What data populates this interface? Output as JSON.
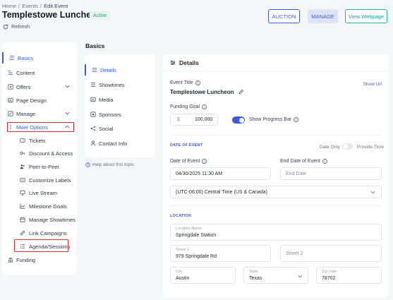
{
  "breadcrumb": {
    "home": "Home",
    "sep1": "/",
    "events": "Events",
    "sep2": "/",
    "current": "Edit Event"
  },
  "page": {
    "title": "Templestowe Luncheon",
    "status": "Active",
    "refresh": "Refresh"
  },
  "header_buttons": {
    "auction": "AUCTION",
    "manage": "MANAGE",
    "view": "View Webpage"
  },
  "sidebar": {
    "basics": "Basics",
    "content": "Content",
    "offers": "Offers",
    "page_design": "Page Design",
    "manage": "Manage",
    "more_options": "More Options",
    "sub": [
      "Tickets",
      "Discount & Access",
      "Peer-to-Peer",
      "Customize Labels",
      "Live Stream",
      "Milestone Goals",
      "Manage Showtimes",
      "Link Campaigns",
      "Agenda/Sessions"
    ],
    "funding": "Funding"
  },
  "basics_title": "Basics",
  "mid_nav": [
    "Details",
    "Showtimes",
    "Media",
    "Sponsors",
    "Social",
    "Contact Info"
  ],
  "help_link": "Help about this topic",
  "details": {
    "heading": "Details",
    "event_title_label": "Event Title",
    "show_url": "Show Url",
    "event_title_value": "Templestowe Luncheon",
    "funding_goal_label": "Funding Goal",
    "currency": "$",
    "funding_goal_value": "100,000",
    "show_progress_bar": "Show Progress Bar",
    "date_section": "DATE OF EVENT",
    "date_only": "Date Only",
    "provide_time": "Provide Time",
    "date_label": "Date of Event",
    "date_value": "04/30/2025 11:30 AM",
    "end_date_label": "End Date of Event",
    "end_date_placeholder": "End Date",
    "timezone": "(UTC-06:00) Central Time (US & Canada)",
    "location_section": "LOCATION",
    "location_name_label": "Location Name",
    "location_name": "Springdale Station",
    "street1_label": "Street 1",
    "street1": "979 Springdale Rd",
    "street2_placeholder": "Street 2",
    "city_label": "City",
    "city": "Austin",
    "state_label": "State",
    "state": "Texas",
    "zip_label": "Zip code",
    "zip": "78702"
  }
}
